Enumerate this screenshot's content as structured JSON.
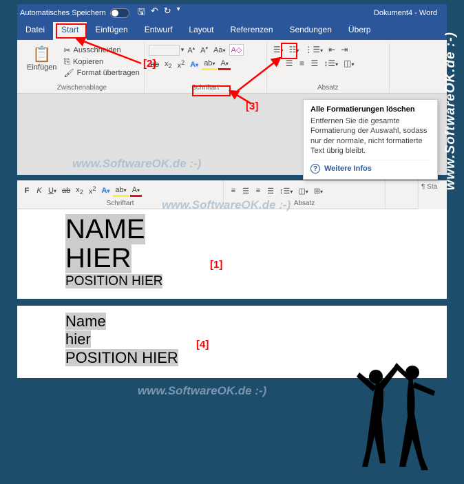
{
  "title_bar": {
    "autosave": "Automatisches Speichern",
    "doc_title": "Dokument4  -  Word"
  },
  "tabs": [
    "Datei",
    "Start",
    "Einfügen",
    "Entwurf",
    "Layout",
    "Referenzen",
    "Sendungen",
    "Überp"
  ],
  "clipboard": {
    "paste": "Einfügen",
    "cut": "Ausschneiden",
    "copy": "Kopieren",
    "format": "Format übertragen",
    "group_label": "Zwischenablage"
  },
  "font": {
    "group_label": "Schriftart"
  },
  "para": {
    "group_label": "Absatz"
  },
  "tooltip": {
    "title": "Alle Formatierungen löschen",
    "body": "Entfernen Sie die gesamte Formatierung der Auswahl, sodass nur der normale, nicht formatierte Text übrig bleibt.",
    "link": "Weitere Infos"
  },
  "callouts": {
    "c1": "[1]",
    "c2": "[2]",
    "c3": "[3]",
    "c4": "[4]"
  },
  "doc1": {
    "line1": "NAME",
    "line2": "HIER",
    "line3": "POSITION HIER"
  },
  "doc2": {
    "line1": "Name",
    "line2": "hier",
    "line3": "POSITION HIER"
  },
  "ruler": {
    "sta": "¶ Sta"
  },
  "watermark": "www.SoftwareOK.de :-)"
}
